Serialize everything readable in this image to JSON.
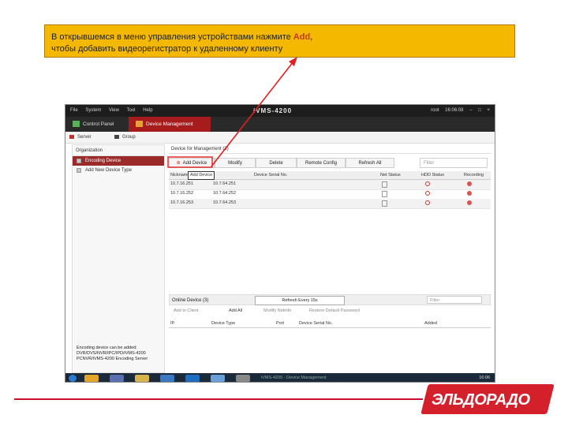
{
  "callout": {
    "line1_before": "В открывшемся в меню управления устройствами нажмите ",
    "line1_highlight": "Add",
    "line1_after": ",",
    "line2": "чтобы добавить видеорегистратор к удаленному клиенту"
  },
  "app": {
    "menu": [
      "File",
      "System",
      "View",
      "Tool",
      "Help"
    ],
    "title": "iVMS-4200",
    "right_info": [
      "root",
      "16:06:08"
    ],
    "tabs": [
      "Control Panel",
      "Device Management"
    ],
    "subtabs": [
      "Server",
      "Group"
    ]
  },
  "left_panel": {
    "header": "Organization",
    "items": [
      "Encoding Device",
      "Add New Device Type"
    ],
    "note": "Encoding device can be added: DVR/DVS/NVR/IPC/IPD/iVMS-4200 PCNVR/iVMS-4200 Encoding Server"
  },
  "main": {
    "title": "Device for Management (3)",
    "toolbar": {
      "add": "Add Device",
      "modify": "Modify",
      "delete": "Delete",
      "remote_config": "Remote Config",
      "refresh_all": "Refresh All",
      "filter": "Filter"
    },
    "columns": [
      "Nickname",
      "Add Device",
      "Device Serial No.",
      "Net Status",
      "HDD Status",
      "Recording"
    ],
    "rows": [
      [
        "10.7.16.251",
        "10.7.64.251"
      ],
      [
        "10.7.16.252",
        "10.7.64.252"
      ],
      [
        "10.7.16.253",
        "10.7.64.253"
      ]
    ]
  },
  "online": {
    "label": "Online Device (3)",
    "refresh": "Refresh Every 15s",
    "filter": "Filter",
    "tools": [
      "Add to Client",
      "Add All",
      "Modify Netinfo",
      "Restore Default Password"
    ],
    "columns": [
      "IP",
      "Device Type",
      "Port",
      "Device Serial No.",
      "Added"
    ]
  },
  "taskbar": {
    "status": "iVMS-4200 - Device Management",
    "clock": "16:06"
  },
  "brand": {
    "logo": "ЭЛЬДОРАДО",
    "color": "#d4202a"
  }
}
